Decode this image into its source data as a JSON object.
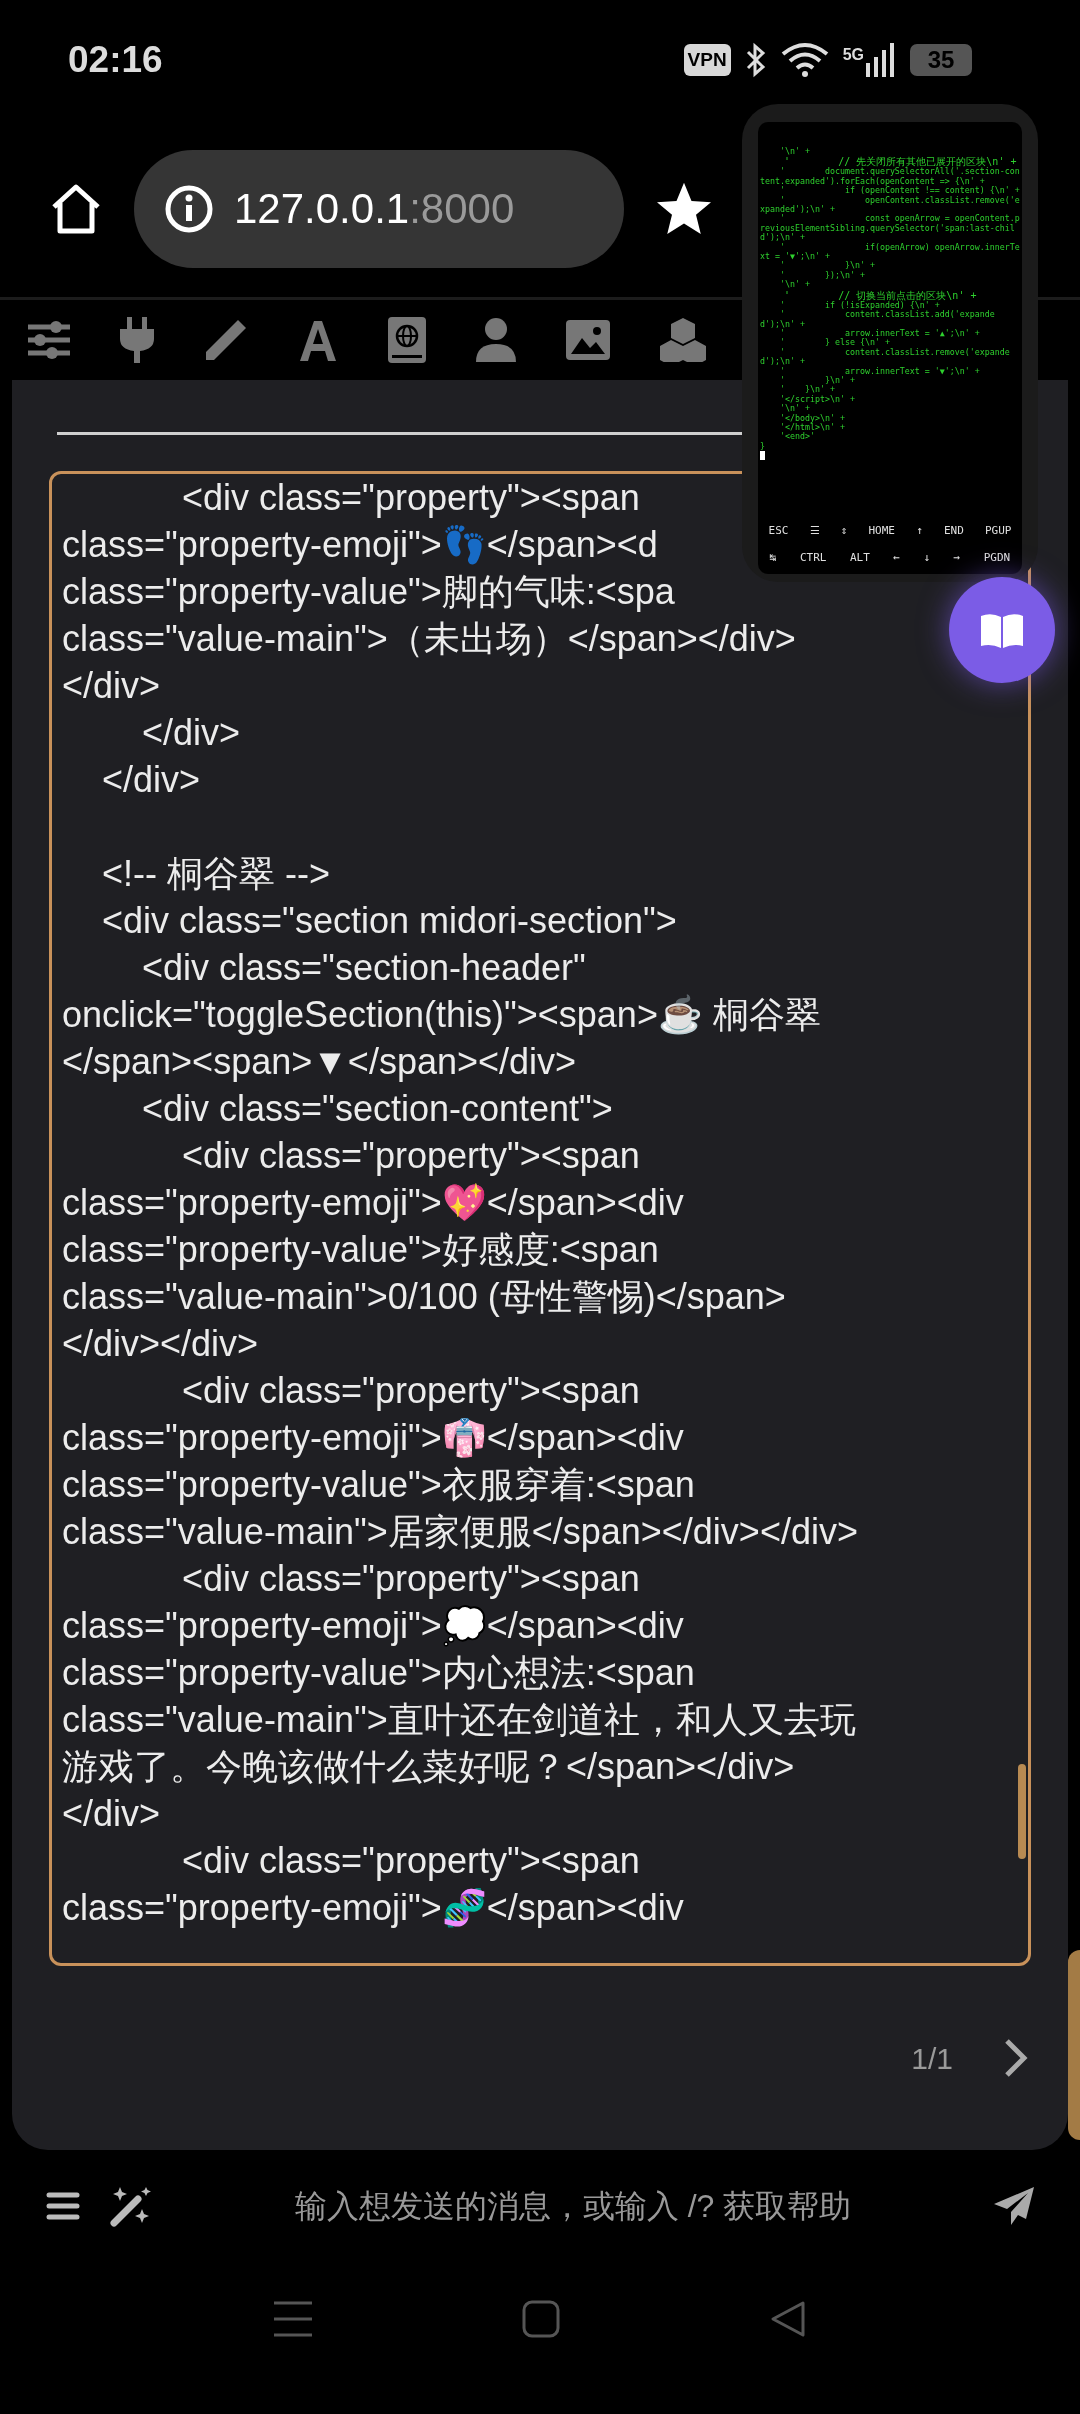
{
  "status_bar": {
    "time": "02:16",
    "vpn": "VPN",
    "network": "5G",
    "battery": "35"
  },
  "address_bar": {
    "host": "127.0.0.1",
    "port": ":8000"
  },
  "editor": {
    "blocks": [
      [
        "            <div class=\"property\"><span",
        "class=\"property-emoji\">👣</span><d",
        "class=\"property-value\">脚的气味:<spa",
        "class=\"value-main\">（未出场）</span></div>",
        "</div>",
        "        </div>",
        "    </div>"
      ],
      [
        "    <!-- 桐谷翠 -->",
        "    <div class=\"section midori-section\">",
        "        <div class=\"section-header\"",
        "onclick=\"toggleSection(this)\"><span>☕ 桐谷翠",
        "</span><span>▼</span></div>",
        "        <div class=\"section-content\">",
        "            <div class=\"property\"><span",
        "class=\"property-emoji\">💖</span><div",
        "class=\"property-value\">好感度:<span",
        "class=\"value-main\">0/100 (母性警惕)</span>",
        "</div></div>",
        "            <div class=\"property\"><span",
        "class=\"property-emoji\">👘</span><div",
        "class=\"property-value\">衣服穿着:<span",
        "class=\"value-main\">居家便服</span></div></div>",
        "            <div class=\"property\"><span",
        "class=\"property-emoji\">💭</span><div",
        "class=\"property-value\">内心想法:<span",
        "class=\"value-main\">直叶还在剑道社，和人又去玩",
        "游戏了。今晚该做什么菜好呢？</span></div>",
        "</div>",
        "            <div class=\"property\"><span",
        "class=\"property-emoji\">🧬</span><div"
      ]
    ]
  },
  "pager": {
    "label": "1/1"
  },
  "message_input": {
    "placeholder": "输入想发送的消息，或输入 /? 获取帮助"
  },
  "terminal": {
    "lines": [
      {
        "text": "    '\\n' +",
        "kind": "ascii"
      },
      {
        "text": "    '        // 先关闭所有其他已展开的区块\\n' +",
        "kind": "cjk"
      },
      {
        "text": "    '        document.querySelectorAll('.section-content.expanded').forEach(openContent => {\\n' +",
        "kind": "ascii"
      },
      {
        "text": "    '            if (openContent !== content) {\\n' +",
        "kind": "ascii"
      },
      {
        "text": "    '                openContent.classList.remove('expanded');\\n' +",
        "kind": "ascii"
      },
      {
        "text": "    '                const openArrow = openContent.previousElementSibling.querySelector('span:last-child');\\n' +",
        "kind": "ascii"
      },
      {
        "text": "    '                if(openArrow) openArrow.innerText = '▼';\\n' +",
        "kind": "ascii"
      },
      {
        "text": "    '            }\\n' +",
        "kind": "ascii"
      },
      {
        "text": "    '        });\\n' +",
        "kind": "ascii"
      },
      {
        "text": "    '\\n' +",
        "kind": "ascii"
      },
      {
        "text": "    '        // 切换当前点击的区块\\n' +",
        "kind": "cjk"
      },
      {
        "text": "    '        if (!isExpanded) {\\n' +",
        "kind": "ascii"
      },
      {
        "text": "    '            content.classList.add('expanded');\\n' +",
        "kind": "ascii"
      },
      {
        "text": "    '            arrow.innerText = '▲';\\n' +",
        "kind": "ascii"
      },
      {
        "text": "    '        } else {\\n' +",
        "kind": "ascii"
      },
      {
        "text": "    '            content.classList.remove('expanded');\\n' +",
        "kind": "ascii"
      },
      {
        "text": "    '            arrow.innerText = '▼';\\n' +",
        "kind": "ascii"
      },
      {
        "text": "    '        }\\n' +",
        "kind": "ascii"
      },
      {
        "text": "    '    }\\n' +",
        "kind": "ascii"
      },
      {
        "text": "    '</script>\\n' +",
        "kind": "ascii"
      },
      {
        "text": "    '\\n' +",
        "kind": "ascii"
      },
      {
        "text": "    '</body>\\n' +",
        "kind": "ascii"
      },
      {
        "text": "    '</html>\\n' +",
        "kind": "ascii"
      },
      {
        "text": "    '<end>'",
        "kind": "ascii"
      },
      {
        "text": "}",
        "kind": "ascii"
      }
    ],
    "keys": [
      [
        "ESC",
        "☰",
        "⇕",
        "HOME",
        "↑",
        "END",
        "PGUP"
      ],
      [
        "↹",
        "CTRL",
        "ALT",
        "←",
        "↓",
        "→",
        "PGDN"
      ]
    ]
  }
}
